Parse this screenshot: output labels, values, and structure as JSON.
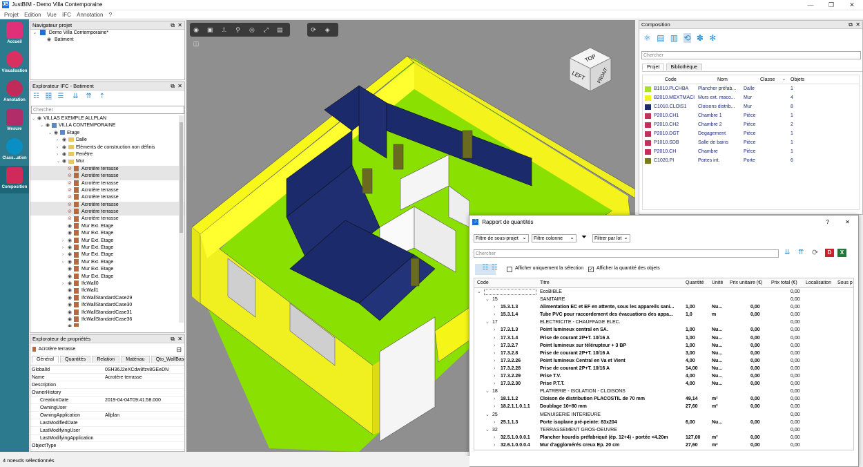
{
  "app": {
    "title": "JustBIM - Demo Villa Contemporaine",
    "icon": "JB"
  },
  "menu": [
    "Projet",
    "Edition",
    "Vue",
    "IFC",
    "Annotation",
    "?"
  ],
  "leftbar": [
    {
      "label": "Accueil",
      "icon": "home-icon",
      "color": "#e0307a"
    },
    {
      "label": "Visualisation",
      "icon": "visualization-icon",
      "color": "#d83060"
    },
    {
      "label": "Annotation",
      "icon": "annotation-icon",
      "color": "#c02b5a"
    },
    {
      "label": "Mesure",
      "icon": "measure-icon",
      "color": "#b02d6a"
    },
    {
      "label": "Class...ation",
      "icon": "classification-icon",
      "color": "#0a8fc4"
    },
    {
      "label": "Composition",
      "icon": "composition-icon",
      "color": "#d02a5a"
    }
  ],
  "nav": {
    "title": "Navigateur projet",
    "project": "Demo Villa Contemporaine*",
    "child": "Batiment"
  },
  "ifc": {
    "title": "Explorateur IFC - Batiment",
    "search_placeholder": "Chercher",
    "rows": [
      "VILLAS EXEMPLE ALLPLAN",
      "VILLA CONTEMPORAINE",
      "Etage",
      "Dalle",
      "Eléments de construction non définis",
      "Fenêtre",
      "Mur",
      "Acrotère terrasse",
      "Acrotère terrasse",
      "Acrotère terrasse",
      "Acrotère terrasse",
      "Acrotère terrasse",
      "Acrotère terrasse",
      "Acrotère terrasse",
      "Acrotère terrasse",
      "Mur Ext. Etage",
      "Mur Ext. Etage",
      "Mur Ext. Etage",
      "Mur Ext. Etage",
      "Mur Ext. Etage",
      "Mur Ext. Etage",
      "Mur Ext. Etage",
      "Mur Ext. Etage",
      "IfcWall0",
      "IfcWall1",
      "IfcWallStandardCase29",
      "IfcWallStandardCase30",
      "IfcWallStandardCase31",
      "IfcWallStandardCase36"
    ]
  },
  "props": {
    "title": "Explorateur de propriétés",
    "selected": "Acrotère terrasse",
    "tabs": [
      "Général",
      "Quantités",
      "Relation",
      "Matériau",
      "Qto_WallBase"
    ],
    "rows": [
      {
        "k": "GlobalId",
        "v": "0SH36J2eXCdw8fzv8GEeDN"
      },
      {
        "k": "Name",
        "v": "Acrotère terrasse"
      },
      {
        "k": "Description",
        "v": ""
      },
      {
        "k": "OwnerHistory",
        "v": ""
      },
      {
        "k": "CreationDate",
        "v": "2019-04-04T09:41:58.000"
      },
      {
        "k": "OwningUser",
        "v": ""
      },
      {
        "k": "OwningApplication",
        "v": "Allplan"
      },
      {
        "k": "LastModifiedDate",
        "v": ""
      },
      {
        "k": "LastModifyingUser",
        "v": ""
      },
      {
        "k": "LastModifyingApplication",
        "v": ""
      },
      {
        "k": "ObjectType",
        "v": ""
      }
    ]
  },
  "viewcube": {
    "top": "TOP",
    "left": "LEFT",
    "front": "FRONT"
  },
  "composition": {
    "title": "Composition",
    "search_placeholder": "Chercher",
    "tabs": [
      "Projet",
      "Bibliothèque"
    ],
    "headers": [
      "Code",
      "Nom",
      "Classe",
      "Objets"
    ],
    "rows": [
      {
        "color": "#a8e02a",
        "code": "B1010.PLCHBA",
        "nom": "Plancher préfab...",
        "classe": "Dalle",
        "objets": "1"
      },
      {
        "color": "#f0f020",
        "code": "B2010.MEXTMACI",
        "nom": "Murs ext. maco...",
        "classe": "Mur",
        "objets": "4"
      },
      {
        "color": "#1a2a6a",
        "code": "C1010.CLOIS1",
        "nom": "Cloisons distrib...",
        "classe": "Mur",
        "objets": "8"
      },
      {
        "color": "#c0305a",
        "code": "P2010.CH1",
        "nom": "Chambre 1",
        "classe": "Pièce",
        "objets": "1"
      },
      {
        "color": "#c0305a",
        "code": "P2010.CH2",
        "nom": "Chambre 2",
        "classe": "Pièce",
        "objets": "2"
      },
      {
        "color": "#c0305a",
        "code": "P2010.DGT",
        "nom": "Degagement",
        "classe": "Pièce",
        "objets": "1"
      },
      {
        "color": "#c0305a",
        "code": "P1010.SDB",
        "nom": "Salle de bains",
        "classe": "Pièce",
        "objets": "1"
      },
      {
        "color": "#c0305a",
        "code": "P2010.CH",
        "nom": "Chambre",
        "classe": "Pièce",
        "objets": "1"
      },
      {
        "color": "#7a7a1a",
        "code": "C1020.PI",
        "nom": "Portes int.",
        "classe": "Porte",
        "objets": "6"
      }
    ]
  },
  "report": {
    "title": "Rapport de quantités",
    "help": "?",
    "close": "✕",
    "filter_subproject": "Filtre de sous-projet",
    "filter_column": "Filtre colonne",
    "filter_lot": "Filtrer par lot",
    "search_placeholder": "Chercher",
    "chk_selection": "Afficher uniquement la sélection",
    "chk_quantity": "Afficher la quantité des objets",
    "headers": [
      "Code",
      "Titre",
      "Quantité",
      "Unité",
      "Prix unitaire (€)",
      "Prix total (€)",
      "Localisation",
      "Sous p"
    ],
    "rows": [
      {
        "lvl": 0,
        "code": "",
        "titre": "EcoBIBLE",
        "q": "",
        "u": "",
        "pu": "",
        "pt": "0,00",
        "bold": false
      },
      {
        "lvl": 1,
        "code": "15",
        "titre": "SANITAIRE",
        "q": "",
        "u": "",
        "pu": "",
        "pt": "0,00",
        "bold": false
      },
      {
        "lvl": 2,
        "code": "15.3.1.3",
        "titre": "Alimentation EC et EF en attente, sous les appareils sani...",
        "q": "1,00",
        "u": "Nu...",
        "pu": "0,00",
        "pt": "0,00",
        "bold": true
      },
      {
        "lvl": 2,
        "code": "15.3.1.4",
        "titre": "Tube PVC pour raccordement des évacuations des appa...",
        "q": "1,0",
        "u": "m",
        "pu": "0,00",
        "pt": "0,00",
        "bold": true
      },
      {
        "lvl": 1,
        "code": "17",
        "titre": "ELECTRICITE - CHAUFFAGE ELEC.",
        "q": "",
        "u": "",
        "pu": "",
        "pt": "0,00",
        "bold": false
      },
      {
        "lvl": 2,
        "code": "17.3.1.3",
        "titre": "Point lumineux central en SA.",
        "q": "1,00",
        "u": "Nu...",
        "pu": "0,00",
        "pt": "0,00",
        "bold": true
      },
      {
        "lvl": 2,
        "code": "17.3.1.4",
        "titre": "Prise de courant 2P+T. 10/16  A",
        "q": "1,00",
        "u": "Nu...",
        "pu": "0,00",
        "pt": "0,00",
        "bold": true
      },
      {
        "lvl": 2,
        "code": "17.3.2.7",
        "titre": "Point lumineux sur télérupteur + 3 BP",
        "q": "1,00",
        "u": "Nu...",
        "pu": "0,00",
        "pt": "0,00",
        "bold": true
      },
      {
        "lvl": 2,
        "code": "17.3.2.8",
        "titre": "Prise de courant 2P+T. 10/16  A",
        "q": "3,00",
        "u": "Nu...",
        "pu": "0,00",
        "pt": "0,00",
        "bold": true
      },
      {
        "lvl": 2,
        "code": "17.3.2.26",
        "titre": "Point lumineux Central en Va et Vient",
        "q": "4,00",
        "u": "Nu...",
        "pu": "0,00",
        "pt": "0,00",
        "bold": true
      },
      {
        "lvl": 2,
        "code": "17.3.2.28",
        "titre": "Prise de courant 2P+T. 10/16  A",
        "q": "14,00",
        "u": "Nu...",
        "pu": "0,00",
        "pt": "0,00",
        "bold": true
      },
      {
        "lvl": 2,
        "code": "17.3.2.29",
        "titre": "Prise T.V.",
        "q": "4,00",
        "u": "Nu...",
        "pu": "0,00",
        "pt": "0,00",
        "bold": true
      },
      {
        "lvl": 2,
        "code": "17.3.2.30",
        "titre": "Prise P.T.T.",
        "q": "4,00",
        "u": "Nu...",
        "pu": "0,00",
        "pt": "0,00",
        "bold": true
      },
      {
        "lvl": 1,
        "code": "18",
        "titre": "PLATRERIE - ISOLATION - CLOISONS",
        "q": "",
        "u": "",
        "pu": "",
        "pt": "0,00",
        "bold": false
      },
      {
        "lvl": 2,
        "code": "18.1.1.2",
        "titre": "Cloison de distribution PLACOSTIL de 70 mm",
        "q": "49,14",
        "u": "m²",
        "pu": "0,00",
        "pt": "0,00",
        "bold": true
      },
      {
        "lvl": 2,
        "code": "18.2.1.1.0.1.1",
        "titre": "Doublage 10+80 mm",
        "q": "27,60",
        "u": "m²",
        "pu": "0,00",
        "pt": "0,00",
        "bold": true
      },
      {
        "lvl": 1,
        "code": "25",
        "titre": "MENUISERIE INTERIEURE",
        "q": "",
        "u": "",
        "pu": "",
        "pt": "0,00",
        "bold": false
      },
      {
        "lvl": 2,
        "code": "25.1.1.3",
        "titre": "Porte isoplane pré-peinte: 83x204",
        "q": "6,00",
        "u": "Nu...",
        "pu": "0,00",
        "pt": "0,00",
        "bold": true
      },
      {
        "lvl": 1,
        "code": "32",
        "titre": "TERRASSEMENT GROS-OEUVRE",
        "q": "",
        "u": "",
        "pu": "",
        "pt": "0,00",
        "bold": false
      },
      {
        "lvl": 2,
        "code": "32.5.1.0.0.0.1",
        "titre": "Plancher hourdis préfabriqué (ép. 12+4) - portée <4.20m",
        "q": "127,00",
        "u": "m²",
        "pu": "0,00",
        "pt": "0,00",
        "bold": true
      },
      {
        "lvl": 2,
        "code": "32.6.1.0.0.0.4",
        "titre": "Mur d'agglomérés creux Ep. 20 cm",
        "q": "27,60",
        "u": "m²",
        "pu": "0,00",
        "pt": "0,00",
        "bold": true
      }
    ]
  },
  "status": "4 noeuds sélectionnés"
}
